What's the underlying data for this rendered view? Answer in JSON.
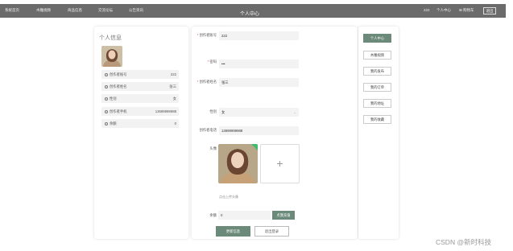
{
  "nav": {
    "items": [
      "系统首页",
      "木雕视频",
      "商品信息",
      "交流论坛",
      "公告资讯"
    ],
    "center_title": "个人中心",
    "right_items": [
      "222",
      "个人中心",
      "购物车"
    ],
    "logout_label": "退出"
  },
  "profile": {
    "title": "个人信息",
    "rows": [
      {
        "label": "创作者账号",
        "value": "222"
      },
      {
        "label": "创作者姓名",
        "value": "张三"
      },
      {
        "label": "性别",
        "value": "女"
      },
      {
        "label": "创作者手机",
        "value": "13699999988"
      },
      {
        "label": "余额",
        "value": "0"
      }
    ]
  },
  "form": {
    "account_label": "创作者账号",
    "account_value": "222",
    "password_label": "密码",
    "password_value": "•••",
    "name_label": "创作者姓名",
    "name_value": "张三",
    "gender_label": "性别",
    "gender_value": "女",
    "phone_label": "创作者电话",
    "phone_value": "13699999988",
    "avatar_label": "头像",
    "upload_tip": "点击上传头像",
    "balance_label": "余额",
    "balance_value": "0",
    "recharge_label": "点我充值",
    "update_label": "更新信息",
    "logout_label": "退出登录"
  },
  "side_menu": [
    "个人中心",
    "木雕视频",
    "我的发布",
    "我的订单",
    "我的地址",
    "我的收藏"
  ],
  "watermark": "CSDN @新时科技",
  "colors": {
    "topbar": "#6b6b6b",
    "accent": "#6b8a7a",
    "required": "#e05050"
  }
}
